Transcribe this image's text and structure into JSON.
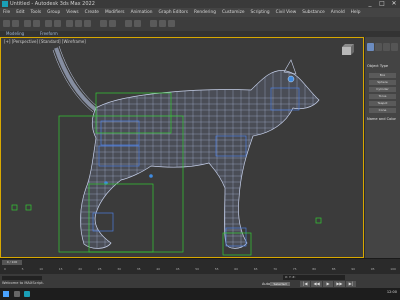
{
  "window": {
    "title": "Untitled - Autodesk 3ds Max 2022",
    "controls": [
      "_",
      "□",
      "✕"
    ]
  },
  "menu": [
    "File",
    "Edit",
    "Tools",
    "Group",
    "Views",
    "Create",
    "Modifiers",
    "Animation",
    "Graph Editors",
    "Rendering",
    "Customize",
    "Scripting",
    "Civil View",
    "Substance",
    "Arnold",
    "Help"
  ],
  "ribbon": {
    "left": "Modeling",
    "right": "Freeform"
  },
  "viewport": {
    "label": "[+] [Perspective] [Standard] [Wireframe]",
    "active_border_color": "#d8a800",
    "wire_color": "#b9c6e6",
    "bone_color": "#33cc33"
  },
  "command_panel": {
    "section": "Object Type",
    "subsection": "Name and Color",
    "buttons": [
      "Box",
      "Sphere",
      "Cylinder",
      "Torus",
      "Teapot",
      "Cone"
    ]
  },
  "timeline": {
    "frame_range": "0 / 100",
    "ticks": [
      "0",
      "5",
      "10",
      "15",
      "20",
      "25",
      "30",
      "35",
      "40",
      "45",
      "50",
      "55",
      "60",
      "65",
      "70",
      "75",
      "80",
      "85",
      "90",
      "95",
      "100"
    ]
  },
  "status": {
    "welcome": "Welcome to MAXScript.",
    "autokey": "Auto Key",
    "selected": "Selected",
    "coords": "X:  Y:  Z:",
    "playback": [
      "|◀",
      "◀◀",
      "▶",
      "▶▶",
      "▶|"
    ]
  },
  "taskbar": {
    "clock": "12:00"
  }
}
